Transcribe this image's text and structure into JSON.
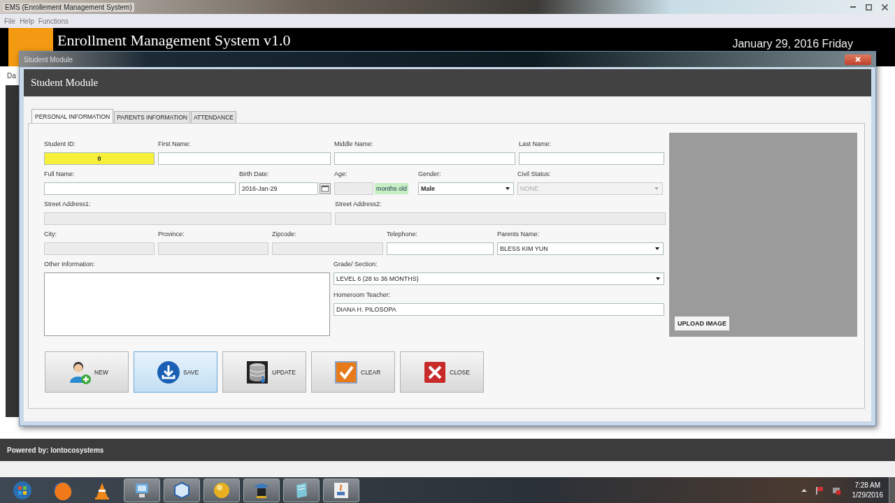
{
  "window": {
    "title": "EMS (Enrollement Management System)"
  },
  "menu": [
    "File",
    "Help",
    "Functions"
  ],
  "header": {
    "title": "Enrollment Management System v1.0",
    "date": "January 29, 2016 Friday"
  },
  "background_tab": "Da",
  "dialog": {
    "title": "Student Module",
    "heading": "Student Module",
    "tabs": [
      {
        "label": "PERSONAL INFORMATION",
        "selected": true
      },
      {
        "label": "PARENTS INFORMATION",
        "selected": false
      },
      {
        "label": "ATTENDANCE",
        "selected": false
      }
    ],
    "rows": [
      {
        "fields": [
          {
            "kind": "text",
            "label": "Student ID:",
            "value": "0",
            "highlighted": true,
            "disabled": false
          },
          {
            "kind": "text",
            "label": "First Name:",
            "disabled": false
          },
          {
            "kind": "text",
            "label": "Middle Name:",
            "disabled": false
          },
          {
            "kind": "text",
            "label": "Last Name:",
            "disabled": false
          }
        ]
      },
      {
        "fields": [
          {
            "kind": "text",
            "label": "Full Name:",
            "disabled": false
          },
          {
            "kind": "date",
            "label": "Birth Date:",
            "value": "2016-Jan-29",
            "disabled": false
          },
          {
            "kind": "age",
            "label": "Age:",
            "unit": "months old",
            "disabled": true
          },
          {
            "kind": "select",
            "label": "Gender:",
            "value": "Male",
            "disabled": false
          },
          {
            "kind": "select",
            "label": "Civil Status:",
            "value": "NONE",
            "disabled": true
          }
        ]
      },
      {
        "fields": [
          {
            "kind": "text",
            "label": "Street Address1:",
            "disabled": true
          },
          {
            "kind": "text",
            "label": "Street Address2:",
            "disabled": true
          }
        ]
      },
      {
        "fields": [
          {
            "kind": "text",
            "label": "City:",
            "disabled": true
          },
          {
            "kind": "text",
            "label": "Province:",
            "disabled": true
          },
          {
            "kind": "text",
            "label": "Zipcode:",
            "disabled": true
          },
          {
            "kind": "text",
            "label": "Telephone:",
            "disabled": false
          },
          {
            "kind": "select",
            "label": "Parents Name:",
            "value": "BLESS KIM YUN",
            "disabled": false
          }
        ]
      },
      {
        "fields": [
          {
            "kind": "textarea",
            "label": "Other Information:",
            "disabled": false
          },
          {
            "kind": "select",
            "label": "Grade/ Section:",
            "value": "LEVEL 6 (28 to 36 MONTHS)",
            "disabled": false
          },
          {
            "kind": "text",
            "label": "Homeroom Teacher:",
            "value": "DIANA H. PILOSOPA",
            "disabled": false
          }
        ]
      }
    ],
    "photo": {
      "button": "UPLOAD IMAGE"
    },
    "buttons": [
      {
        "label": "NEW",
        "kind": "new",
        "selected": false
      },
      {
        "label": "SAVE",
        "kind": "save",
        "selected": true
      },
      {
        "label": "UPDATE",
        "kind": "update",
        "selected": false
      },
      {
        "label": "CLEAR",
        "kind": "clear",
        "selected": false
      },
      {
        "label": "CLOSE",
        "kind": "close",
        "selected": false
      }
    ]
  },
  "status_bar": "Powered by: lontocosystems",
  "taskbar": {
    "apps": [
      {
        "kind": "start",
        "open": false
      },
      {
        "kind": "browser",
        "open": false
      },
      {
        "kind": "cone",
        "open": false
      },
      {
        "kind": "monitor",
        "open": true
      },
      {
        "kind": "cube",
        "open": true
      },
      {
        "kind": "sphere",
        "open": true
      },
      {
        "kind": "hat",
        "open": true
      },
      {
        "kind": "notepad",
        "open": true
      },
      {
        "kind": "java",
        "open": true
      }
    ],
    "clock": {
      "time": "7:28 AM",
      "date": "1/29/2016"
    }
  }
}
